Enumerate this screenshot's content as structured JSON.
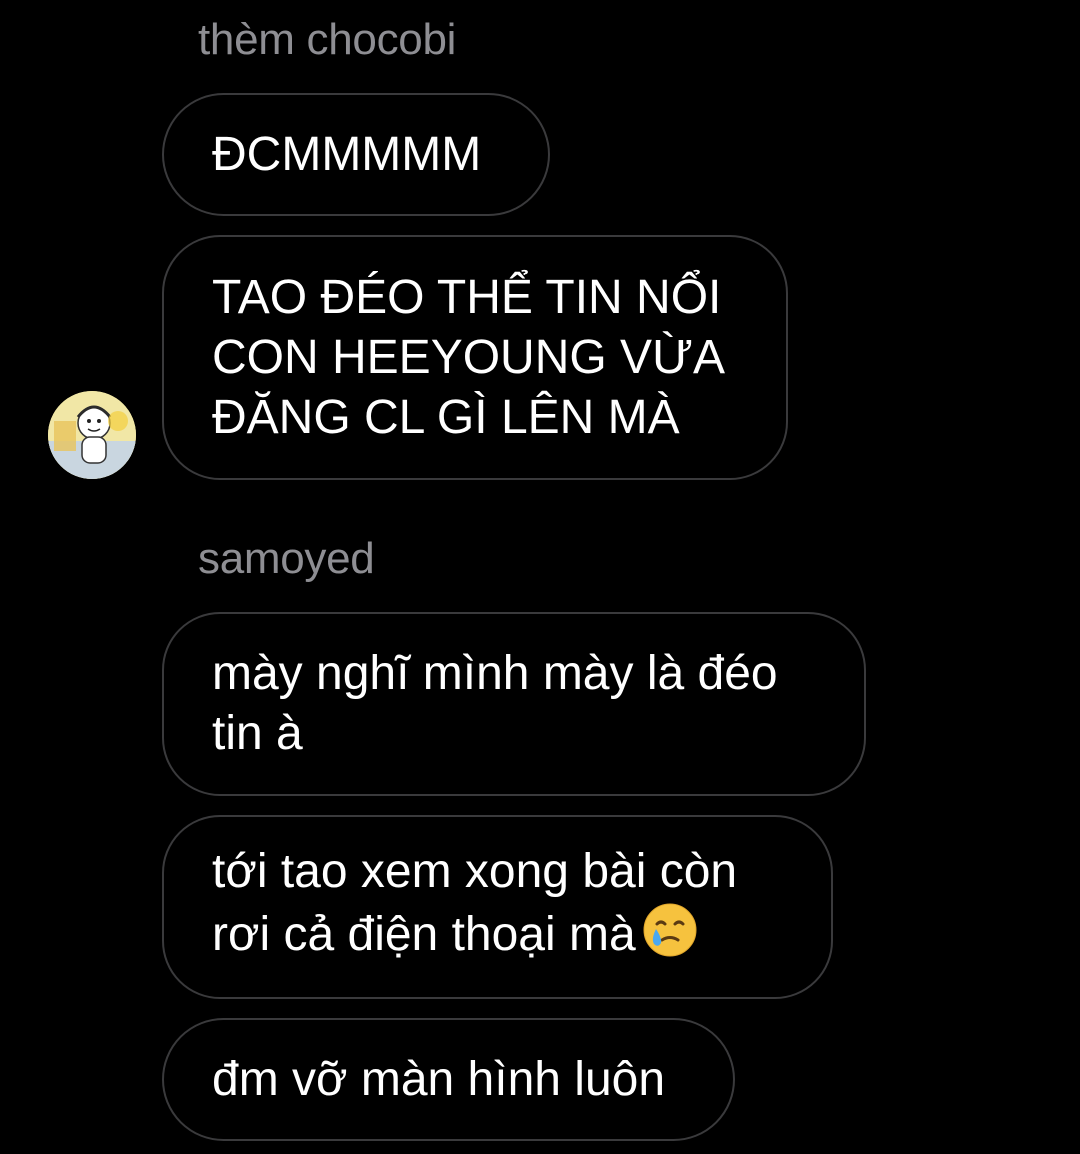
{
  "thread": {
    "groups": [
      {
        "sender": "thèm chocobi",
        "messages": [
          "ĐCMMMMM",
          "TAO ĐÉO THỂ TIN NỔI\nCON HEEYOUNG VỪA\nĐĂNG CL GÌ LÊN MÀ"
        ]
      },
      {
        "sender": "samoyed",
        "messages": [
          "mày nghĩ mình mày là đéo\ntin à",
          "tới tao xem xong bài còn\nrơi cả điện thoại mà",
          "đm vỡ màn hình luôn"
        ]
      }
    ]
  },
  "icons": {
    "avatar": "user-avatar-cartoon",
    "emoji": "crying-face-with-tear-smile-emoji"
  },
  "colors": {
    "background": "#000000",
    "bubble_border": "#3a3a3c",
    "sender_name": "#8e8e93",
    "text": "#ffffff"
  }
}
